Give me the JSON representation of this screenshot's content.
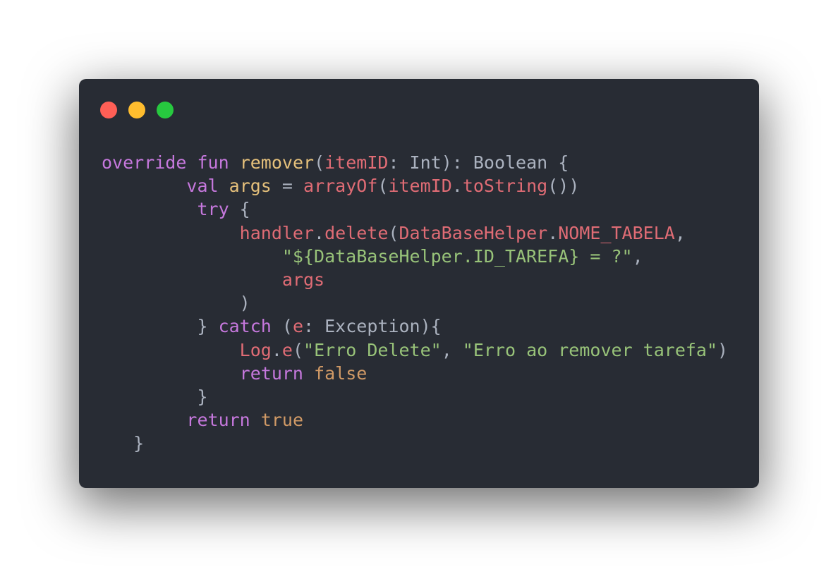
{
  "window": {
    "controls": [
      "close",
      "minimize",
      "maximize"
    ]
  },
  "colors": {
    "background": "#282c34",
    "keyword": "#c678dd",
    "function": "#e5c07b",
    "identifier": "#e06c75",
    "string": "#98c379",
    "literal": "#d19a66",
    "plain": "#abb2bf"
  },
  "code": {
    "l1": {
      "t1": "override",
      "t2": " ",
      "t3": "fun",
      "t4": " ",
      "t5": "remover",
      "t6": "(",
      "t7": "itemID",
      "t8": ": Int): Boolean {"
    },
    "l2": {
      "indent": "        ",
      "t1": "val",
      "t2": " ",
      "t3": "args",
      "t4": " = ",
      "t5": "arrayOf",
      "t6": "(",
      "t7": "itemID",
      "t8": ".",
      "t9": "toString",
      "t10": "())"
    },
    "l3": {
      "indent": "         ",
      "t1": "try",
      "t2": " {"
    },
    "l4": {
      "indent": "             ",
      "t1": "handler",
      "t2": ".",
      "t3": "delete",
      "t4": "(",
      "t5": "DataBaseHelper",
      "t6": ".",
      "t7": "NOME_TABELA",
      "t8": ","
    },
    "l5": {
      "indent": "                 ",
      "t1": "\"${DataBaseHelper.ID_TAREFA} = ?\"",
      "t2": ","
    },
    "l6": {
      "indent": "                 ",
      "t1": "args"
    },
    "l7": {
      "indent": "             ",
      "t1": ")"
    },
    "l8": {
      "indent": "         ",
      "t1": "} ",
      "t2": "catch",
      "t3": " (",
      "t4": "e",
      "t5": ": Exception){"
    },
    "l9": {
      "indent": "             ",
      "t1": "Log",
      "t2": ".",
      "t3": "e",
      "t4": "(",
      "t5": "\"Erro Delete\"",
      "t6": ", ",
      "t7": "\"Erro ao remover tarefa\"",
      "t8": ")"
    },
    "l10": {
      "indent": "             ",
      "t1": "return",
      "t2": " ",
      "t3": "false"
    },
    "l11": {
      "indent": "         ",
      "t1": "}"
    },
    "l12": {
      "indent": "        ",
      "t1": "return",
      "t2": " ",
      "t3": "true"
    },
    "l13": {
      "indent": "   ",
      "t1": "}"
    }
  }
}
